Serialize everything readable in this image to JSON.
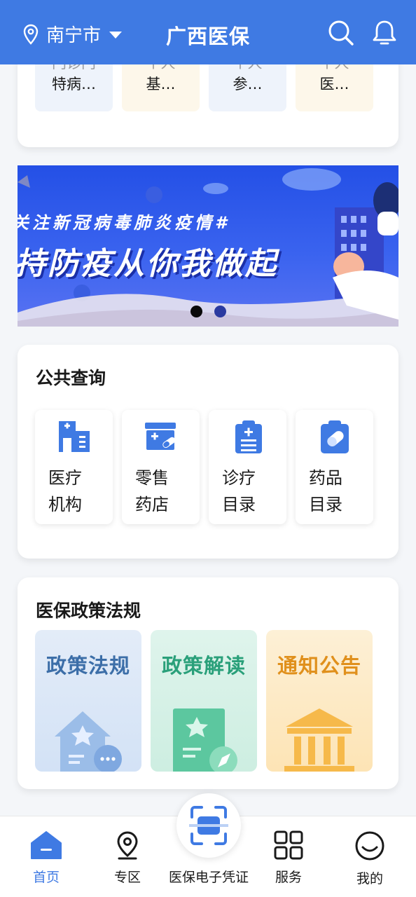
{
  "header": {
    "city": "南宁市",
    "title": "广西医保",
    "icons": [
      "location-pin-icon",
      "search-icon",
      "bell-icon"
    ]
  },
  "top_items": [
    {
      "line1": "门诊门",
      "line2": "特病…",
      "bg": "#eef3fb"
    },
    {
      "line1": "个人",
      "line2": "基…",
      "bg": "#fdf7ea"
    },
    {
      "line1": "个人",
      "line2": "参…",
      "bg": "#eef3fb"
    },
    {
      "line1": "个人",
      "line2": "医…",
      "bg": "#fdf7ea"
    }
  ],
  "banner": {
    "line1": "关注新冠病毒肺炎疫情#",
    "line2": "持防疫从你我做起",
    "active_slide": 1,
    "slide_count": 2
  },
  "public_query": {
    "title": "公共查询",
    "items": [
      {
        "label": "医疗机构",
        "icon": "hospital-icon"
      },
      {
        "label": "零售药店",
        "icon": "pharmacy-icon"
      },
      {
        "label": "诊疗目录",
        "icon": "clipboard-list-icon"
      },
      {
        "label": "药品目录",
        "icon": "pill-clipboard-icon"
      }
    ]
  },
  "policy": {
    "title": "医保政策法规",
    "items": [
      {
        "label": "政策法规",
        "color": "#3c6ea8",
        "bg": "#e3ecf8",
        "icon": "house-chat-icon"
      },
      {
        "label": "政策解读",
        "color": "#2aa07a",
        "bg": "#dff4ec",
        "icon": "book-compass-icon"
      },
      {
        "label": "通知公告",
        "color": "#e0901c",
        "bg": "#fdf0d6",
        "icon": "building-columns-icon"
      }
    ]
  },
  "tabbar": {
    "home": "首页",
    "zone": "专区",
    "voucher": "医保电子凭证",
    "service": "服务",
    "mine": "我的",
    "active": "首页",
    "active_color": "#3f7ae3"
  }
}
